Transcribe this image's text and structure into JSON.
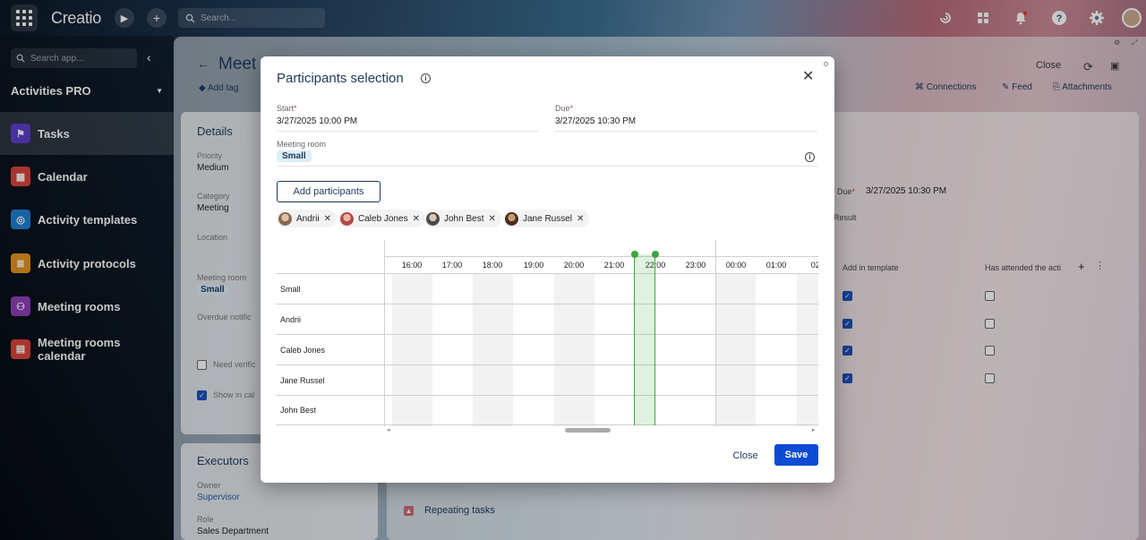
{
  "topbar": {
    "logo": "Creatio",
    "search_placeholder": "Search...",
    "colors": {
      "brand": "#0d4bd4"
    }
  },
  "sidebar": {
    "search_placeholder": "Search app...",
    "app_name": "Activities PRO",
    "items": [
      {
        "label": "Tasks",
        "icon": "flag-icon",
        "color": "#5b3fc7"
      },
      {
        "label": "Calendar",
        "icon": "calendar-icon",
        "color": "#d9453b"
      },
      {
        "label": "Activity templates",
        "icon": "template-icon",
        "color": "#1f7fd1"
      },
      {
        "label": "Activity protocols",
        "icon": "protocol-icon",
        "color": "#e2941f"
      },
      {
        "label": "Meeting rooms",
        "icon": "people-icon",
        "color": "#8e3fb5"
      },
      {
        "label": "Meeting rooms calendar",
        "icon": "room-calendar-icon",
        "color": "#d9453b"
      }
    ]
  },
  "page": {
    "title": "Meet",
    "add_tag": "Add tag",
    "close": "Close",
    "connections": "Connections",
    "feed": "Feed",
    "attachments": "Attachments"
  },
  "details": {
    "heading": "Details",
    "priority_label": "Priority",
    "priority_value": "Medium",
    "category_label": "Category",
    "category_value": "Meeting",
    "location_label": "Location",
    "meeting_room_label": "Meeting room",
    "meeting_room_value": "Small",
    "overdue_label": "Overdue notific",
    "need_verif_label": "Need verific",
    "show_in_cal_label": "Show in cal"
  },
  "right_panel": {
    "due_label": "Due",
    "due_value": "3/27/2025 10:30 PM",
    "result_label": "Result",
    "col_template": "Add in template",
    "col_attended": "Has attended the acti",
    "rows": [
      {
        "template": true,
        "attended": false
      },
      {
        "template": true,
        "attended": false
      },
      {
        "template": true,
        "attended": false
      },
      {
        "template": true,
        "attended": false
      }
    ],
    "repeating_tasks": "Repeating tasks"
  },
  "executors": {
    "heading": "Executors",
    "owner_label": "Owner",
    "owner_value": "Supervisor",
    "role_label": "Role",
    "role_value": "Sales Department"
  },
  "modal": {
    "title": "Participants selection",
    "start_label": "Start",
    "start_value": "3/27/2025 10:00 PM",
    "due_label": "Due",
    "due_value": "3/27/2025 10:30 PM",
    "meeting_room_label": "Meeting room",
    "meeting_room_value": "Small",
    "add_participants": "Add participants",
    "participants": [
      {
        "name": "Andrii"
      },
      {
        "name": "Caleb Jones"
      },
      {
        "name": "John Best"
      },
      {
        "name": "Jane Russel"
      }
    ],
    "schedule": {
      "hours": [
        "16:00",
        "17:00",
        "18:00",
        "19:00",
        "20:00",
        "21:00",
        "22:00",
        "23:00",
        "00:00",
        "01:00",
        "02:"
      ],
      "rows": [
        "Small",
        "Andrii",
        "Caleb Jones",
        "Jane Russel",
        "John Best"
      ]
    },
    "close": "Close",
    "save": "Save"
  }
}
